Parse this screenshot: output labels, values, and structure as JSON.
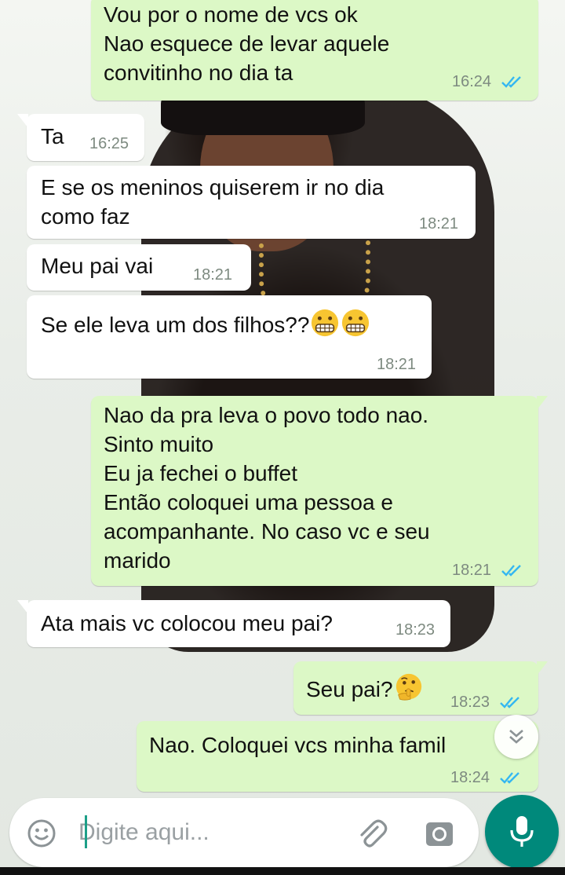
{
  "messages": [
    {
      "direction": "out",
      "text": "Vou por o nome de vcs ok\nNao esquece de levar aquele\nconvitinho no dia ta",
      "time": "16:24",
      "status": "read"
    },
    {
      "direction": "in",
      "text": "Ta",
      "time": "16:25"
    },
    {
      "direction": "in",
      "text": "E se  os meninos quiserem ir  no dia\ncomo faz",
      "time": "18:21"
    },
    {
      "direction": "in",
      "text": "Meu  pai vai",
      "time": "18:21"
    },
    {
      "direction": "in",
      "text": "Se  ele leva um dos filhos??",
      "time": "18:21",
      "emojis": [
        "grimacing-face",
        "grimacing-face"
      ]
    },
    {
      "direction": "out",
      "text": "Nao da pra leva o povo todo nao.\nSinto muito\nEu ja fechei o buffet\nEntão coloquei uma pessoa e\nacompanhante. No caso vc e seu\nmarido",
      "time": "18:21",
      "status": "read"
    },
    {
      "direction": "in",
      "text": "Ata mais vc colocou meu pai?",
      "time": "18:23"
    },
    {
      "direction": "out",
      "text": "Seu pai?",
      "time": "18:23",
      "status": "read",
      "emojis": [
        "thinking-face"
      ]
    },
    {
      "direction": "out",
      "text": "Nao. Coloquei  vcs minha famil",
      "time": "18:24",
      "status": "read"
    }
  ],
  "composer": {
    "placeholder": "Digite aqui...",
    "value": ""
  },
  "icons": {
    "emoji_button": "smiley-icon",
    "attach_button": "paperclip-icon",
    "camera_button": "camera-icon",
    "mic_button": "mic-icon",
    "scroll_button": "double-chevron-down-icon",
    "read_receipt": "double-check-icon"
  },
  "colors": {
    "outgoing_bubble": "#dcf8c6",
    "incoming_bubble": "#ffffff",
    "accent": "#00897b",
    "read_ticks": "#34b7f1",
    "timestamp": "#7d8a80"
  }
}
